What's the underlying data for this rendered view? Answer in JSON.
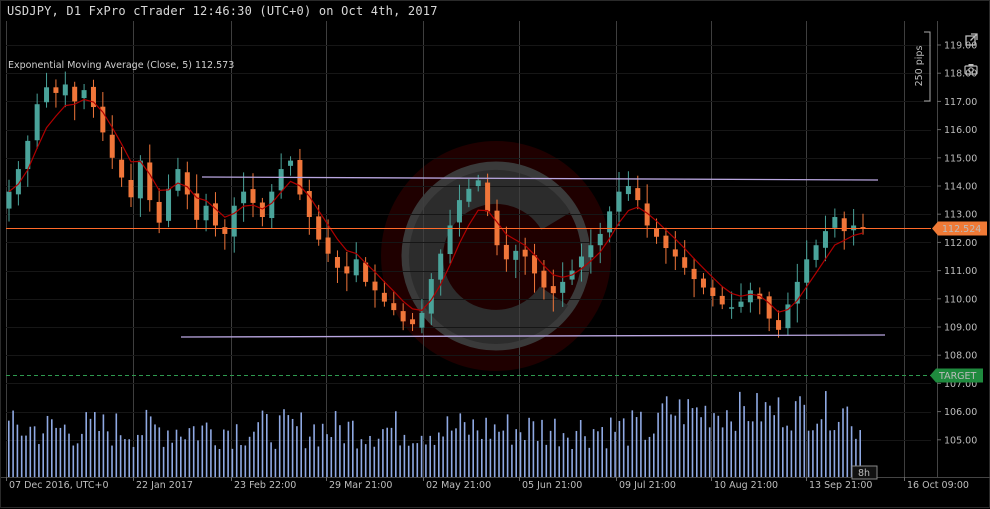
{
  "header": {
    "title": "USDJPY, D1 FxPro cTrader 12:46:30 (UTC+0) on Oct 4th, 2017"
  },
  "indicator": {
    "label": "Exponential Moving Average (Close, 5) 112.573"
  },
  "scale": {
    "label": "250 pips"
  },
  "price_axis": {
    "ticks": [
      "119.00",
      "118.00",
      "117.00",
      "116.00",
      "115.00",
      "114.00",
      "113.00",
      "112.00",
      "111.00",
      "110.00",
      "109.00",
      "108.00",
      "107.00",
      "106.00",
      "105.00"
    ],
    "current_price": "112.524",
    "target_label": "TARGET"
  },
  "time_axis": {
    "labels": [
      "07 Dec 2016, UTC+0",
      "22 Jan 2017",
      "23 Feb 22:00",
      "29 Mar 21:00",
      "02 May 21:00",
      "05 Jun 21:00",
      "09 Jul 21:00",
      "10 Aug 21:00",
      "13 Sep 21:00",
      "16 Oct 09:00"
    ],
    "countdown": "8h"
  },
  "toolbar": {
    "popout_icon": "popout-icon",
    "camera_icon": "camera-icon"
  },
  "colors": {
    "background": "#000000",
    "bull": "#4aa39a",
    "bear": "#f0763a",
    "price_line": "#ff6a2a",
    "trendline": "#b9a6e0",
    "target_line": "#2e9a4f",
    "volume": "#8fa9e3",
    "ema": "#b00000"
  },
  "chart_data": {
    "type": "candlestick",
    "symbol": "USDJPY",
    "timeframe": "D1",
    "ylim": [
      104.6,
      119.3
    ],
    "current_price": 112.524,
    "target_level": 107.3,
    "ema": {
      "period": 5,
      "value": 112.573
    },
    "trendlines": [
      {
        "from": [
          "23 Feb 22:00",
          114.4
        ],
        "to": [
          "16 Oct 09:00",
          114.3
        ]
      },
      {
        "from": [
          "22 Jan 2017",
          108.8
        ],
        "to": [
          "16 Oct 09:00",
          108.8
        ]
      }
    ],
    "closes": [
      113.8,
      114.6,
      115.6,
      116.9,
      117.5,
      117.3,
      117.6,
      117.0,
      117.4,
      116.8,
      115.9,
      115.0,
      114.3,
      113.6,
      114.9,
      113.5,
      112.7,
      113.9,
      114.6,
      113.7,
      112.8,
      113.3,
      112.6,
      112.3,
      113.3,
      113.8,
      113.4,
      112.9,
      113.8,
      114.6,
      114.9,
      113.7,
      112.9,
      112.1,
      111.6,
      111.1,
      110.9,
      111.4,
      110.6,
      110.3,
      109.9,
      109.6,
      109.2,
      109.1,
      109.5,
      110.7,
      111.6,
      112.6,
      113.5,
      113.9,
      114.2,
      113.1,
      111.9,
      111.4,
      111.7,
      111.5,
      110.9,
      110.4,
      110.2,
      110.6,
      111.0,
      111.5,
      111.9,
      112.3,
      113.1,
      113.8,
      114.0,
      113.5,
      112.6,
      112.2,
      111.8,
      111.5,
      111.1,
      110.7,
      110.4,
      110.1,
      109.8,
      109.7,
      109.9,
      110.3,
      110.0,
      109.3,
      108.9,
      109.8,
      110.6,
      111.4,
      111.9,
      112.4,
      112.9,
      112.4,
      112.6,
      112.5
    ]
  }
}
